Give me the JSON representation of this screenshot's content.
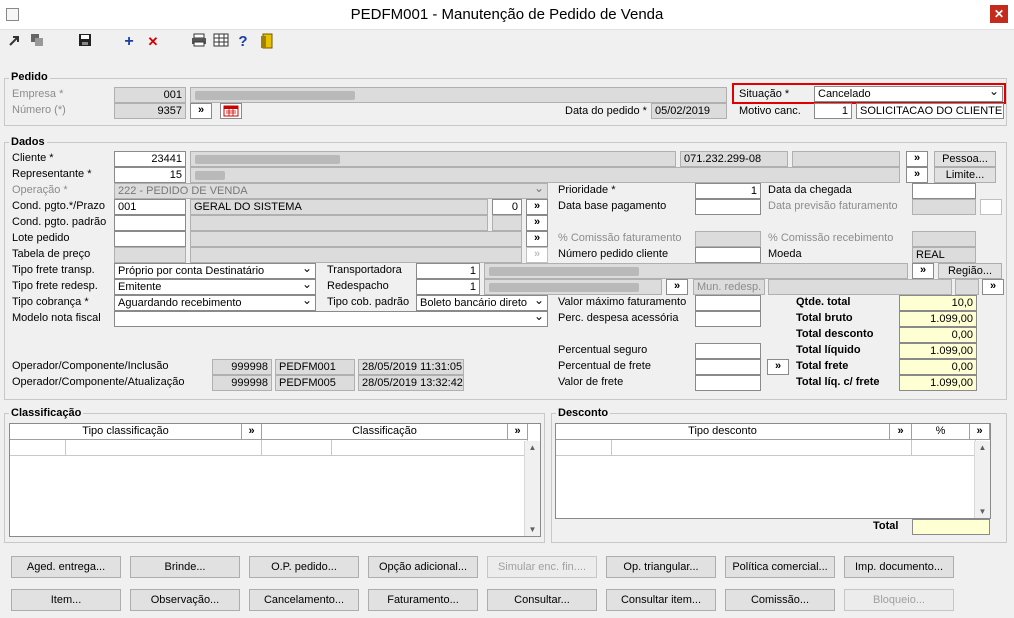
{
  "window": {
    "title": "PEDFM001 - Manutenção de Pedido de Venda",
    "close": "✕"
  },
  "toolbar": {
    "icons": [
      "import-icon",
      "copy-icon",
      "save-icon",
      "add-icon",
      "delete-icon",
      "print-icon",
      "grid-icon",
      "help-icon",
      "exit-icon"
    ],
    "add_glyph": "+",
    "delete_glyph": "✕",
    "help_glyph": "?"
  },
  "pedido": {
    "title": "Pedido",
    "empresa_label": "Empresa *",
    "empresa_value": "001",
    "numero_label": "Número (*)",
    "numero_value": "9357",
    "data_label": "Data do pedido *",
    "data_value": "05/02/2019",
    "situacao_label": "Situação *",
    "situacao_value": "Cancelado",
    "motivo_label": "Motivo canc.",
    "motivo_code": "1",
    "motivo_value": "SOLICITACAO DO CLIENTE",
    "highlight_color": "#e00000"
  },
  "dados": {
    "title": "Dados",
    "cliente_label": "Cliente *",
    "cliente_code": "23441",
    "cliente_doc": "071.232.299-08",
    "pessoa_btn": "Pessoa...",
    "representante_label": "Representante *",
    "representante_code": "15",
    "limite_btn": "Limite...",
    "operacao_label": "Operação *",
    "operacao_value": "222 - PEDIDO DE VENDA",
    "cond_label": "Cond. pgto.*/Prazo",
    "cond_code": "001",
    "cond_value": "GERAL DO SISTEMA",
    "cond_prazo": "0",
    "cond_padrao_label": "Cond. pgto. padrão",
    "lote_label": "Lote pedido",
    "tabela_label": "Tabela de preço",
    "frete_transp_label": "Tipo frete transp.",
    "frete_transp_value": "Próprio por conta Destinatário",
    "frete_redesp_label": "Tipo frete redesp.",
    "frete_redesp_value": "Emitente",
    "cobranca_label": "Tipo cobrança *",
    "cobranca_value": "Aguardando recebimento",
    "modelo_label": "Modelo nota fiscal",
    "transportadora_label": "Transportadora",
    "transportadora_code": "1",
    "redespacho_label": "Redespacho",
    "redespacho_code": "1",
    "tipo_cob_padrao_label": "Tipo cob. padrão",
    "tipo_cob_padrao_value": "Boleto bancário direto",
    "regiao_btn": "Região...",
    "mun_redesp_label": "Mun. redesp.",
    "prioridade_label": "Prioridade *",
    "prioridade_value": "1",
    "data_base_label": "Data base pagamento",
    "comissao_fat_label": "% Comissão faturamento",
    "numero_pedido_cliente_label": "Número pedido cliente",
    "valor_max_label": "Valor máximo faturamento",
    "perc_desp_label": "Perc. despesa acessória",
    "perc_seguro_label": "Percentual seguro",
    "perc_frete_label": "Percentual de frete",
    "valor_frete_label": "Valor de frete",
    "data_chegada_label": "Data da chegada",
    "data_prev_label": "Data previsão faturamento",
    "comissao_rec_label": "% Comissão recebimento",
    "moeda_label": "Moeda",
    "moeda_value": "REAL",
    "qtde_total_label": "Qtde. total",
    "qtde_total_value": "10,0",
    "total_bruto_label": "Total bruto",
    "total_bruto_value": "1.099,00",
    "total_desconto_label": "Total desconto",
    "total_desconto_value": "0,00",
    "total_liquido_label": "Total líquido",
    "total_liquido_value": "1.099,00",
    "total_frete_label": "Total frete",
    "total_frete_value": "0,00",
    "total_liq_frete_label": "Total líq. c/ frete",
    "total_liq_frete_value": "1.099,00",
    "op_incl_label": "Operador/Componente/Inclusão",
    "op_incl_code": "999998",
    "op_incl_comp": "PEDFM001",
    "op_incl_date": "28/05/2019 11:31:05",
    "op_atu_label": "Operador/Componente/Atualização",
    "op_atu_code": "999998",
    "op_atu_comp": "PEDFM005",
    "op_atu_date": "28/05/2019 13:32:42"
  },
  "arrow": "»",
  "classificacao": {
    "title": "Classificação",
    "col1": "Tipo classificação",
    "col2": "Classificação"
  },
  "desconto": {
    "title": "Desconto",
    "col1": "Tipo desconto",
    "col2": "%",
    "total_label": "Total"
  },
  "buttons_row1": [
    "Aged. entrega...",
    "Brinde...",
    "O.P. pedido...",
    "Opção adicional...",
    "Simular enc. fin....",
    "Op. triangular...",
    "Política comercial...",
    "Imp. documento..."
  ],
  "buttons_row2": [
    "Item...",
    "Observação...",
    "Cancelamento...",
    "Faturamento...",
    "Consultar...",
    "Consultar item...",
    "Comissão...",
    "Bloqueio..."
  ]
}
